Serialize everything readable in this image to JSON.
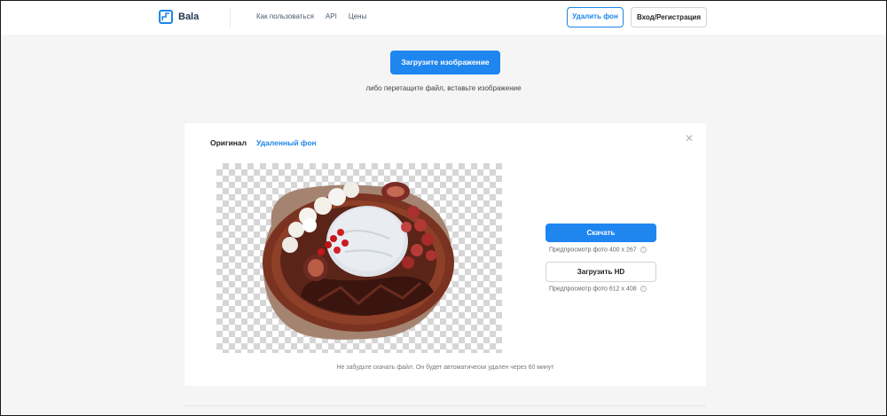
{
  "header": {
    "logo_text": "Bala",
    "nav": [
      "Как пользоваться",
      "API",
      "Цены"
    ],
    "remove_bg_label": "Удалить фон",
    "login_label": "Вход/Регистрация"
  },
  "upload": {
    "button_label": "Загрузите изображение",
    "hint": "либо перетащите файл, вставьте изображение"
  },
  "result": {
    "tabs": [
      "Оригинал",
      "Удаленный фон"
    ],
    "active_tab": "Удаленный фон",
    "download_label": "Скачать",
    "preview_info": "Предпросмотр фото 400 х 267",
    "hd_label": "Загрузить HD",
    "hd_info": "Предпросмотр фото 612 х 408",
    "note": "Не забудьте скачать файл. Он будет автоматически удален через 60 минут"
  },
  "colors": {
    "accent": "#1f86f0",
    "background": "#f5f5f6"
  },
  "icons": {
    "logo": "bala-logo-icon",
    "close": "close-icon",
    "info": "info-icon"
  }
}
